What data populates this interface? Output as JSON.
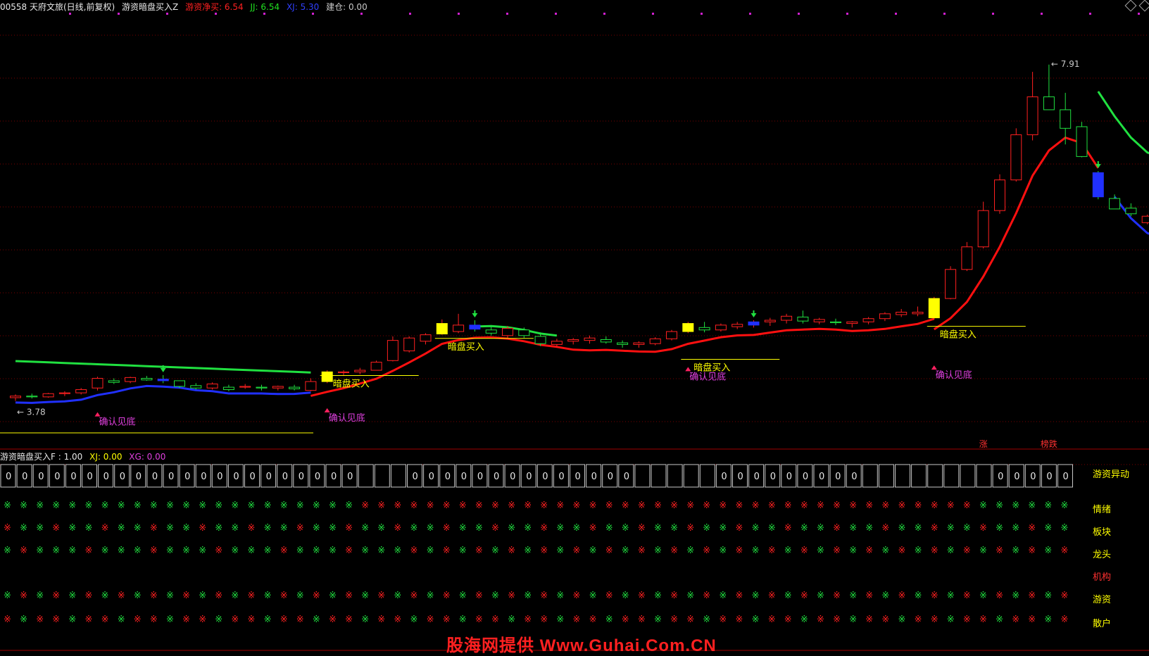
{
  "header": {
    "stock": "00558 天府文旅(日线,前复权)",
    "indicator_name": "游资暗盘买入Z",
    "params": [
      {
        "label": "游资净买: 6.54",
        "color": "#ff2020"
      },
      {
        "label": "JJ: 6.54",
        "color": "#20e020"
      },
      {
        "label": "XJ: 5.30",
        "color": "#3040ff"
      },
      {
        "label": "建仓: 0.00",
        "color": "#c8c8c8"
      }
    ]
  },
  "sub_header": {
    "name": "游资暗盘买入F : 1.00",
    "params": [
      {
        "label": "XJ: 0.00",
        "color": "#ffff00"
      },
      {
        "label": "XG: 0.00",
        "color": "#e040e0"
      }
    ]
  },
  "labels": {
    "buy": "暗盘买入",
    "confirm": "确认见底",
    "high": "7.91",
    "low": "3.78",
    "zhang": "涨",
    "bangdie": "榜跌",
    "watermark": "股海网提供 Www.Guhai.Com.CN"
  },
  "buy_signals": [
    {
      "index": 19,
      "price": 4.16
    },
    {
      "index": 26,
      "price": 4.62
    },
    {
      "index": 41,
      "price": 4.36
    },
    {
      "index": 56,
      "price": 4.77
    }
  ],
  "confirm_signals": [
    {
      "index": 5,
      "price": 3.74
    },
    {
      "index": 19,
      "price": 3.79
    },
    {
      "index": 41,
      "price": 4.3
    },
    {
      "index": 56,
      "price": 4.32
    }
  ],
  "sub_panel": {
    "zero_count": 66,
    "boxes_with_zero": [
      0,
      1,
      2,
      3,
      4,
      5,
      6,
      7,
      8,
      9,
      10,
      11,
      12,
      13,
      14,
      15,
      16,
      17,
      18,
      19,
      20,
      21,
      25,
      26,
      27,
      28,
      29,
      30,
      31,
      32,
      33,
      34,
      35,
      36,
      37,
      38,
      44,
      45,
      46,
      47,
      48,
      49,
      50,
      51,
      52,
      61,
      62,
      63,
      64,
      65
    ],
    "row_labels": [
      "游资异动",
      "情绪",
      "板块",
      "龙头",
      "机构",
      "游资",
      "散户"
    ],
    "row_label_colors": [
      "#ffff00",
      "#ffff00",
      "#ffff00",
      "#ffff00",
      "#ff3030",
      "#ffff00",
      "#ffff00"
    ]
  },
  "chart_data": {
    "type": "candlestick",
    "title": "00558 天府文旅(日线,前复权)",
    "y_range": [
      3.3,
      8.1
    ],
    "candles": [
      [
        3.78,
        3.82,
        3.74,
        3.8
      ],
      [
        3.8,
        3.83,
        3.77,
        3.79
      ],
      [
        3.79,
        3.84,
        3.78,
        3.83
      ],
      [
        3.83,
        3.86,
        3.8,
        3.84
      ],
      [
        3.84,
        3.9,
        3.82,
        3.88
      ],
      [
        3.9,
        4.04,
        3.87,
        4.02
      ],
      [
        3.99,
        4.02,
        3.95,
        3.97
      ],
      [
        3.98,
        4.04,
        3.96,
        4.03
      ],
      [
        4.02,
        4.05,
        3.99,
        4.0
      ],
      [
        4.01,
        4.06,
        3.96,
        3.99
      ],
      [
        3.99,
        3.99,
        3.9,
        3.92
      ],
      [
        3.93,
        3.96,
        3.88,
        3.9
      ],
      [
        3.9,
        3.97,
        3.88,
        3.95
      ],
      [
        3.91,
        3.94,
        3.86,
        3.88
      ],
      [
        3.91,
        3.95,
        3.89,
        3.92
      ],
      [
        3.91,
        3.94,
        3.87,
        3.9
      ],
      [
        3.9,
        3.93,
        3.87,
        3.92
      ],
      [
        3.91,
        3.94,
        3.87,
        3.89
      ],
      [
        3.87,
        4.02,
        3.86,
        3.98
      ],
      [
        3.98,
        4.12,
        3.96,
        4.1
      ],
      [
        4.09,
        4.12,
        4.05,
        4.1
      ],
      [
        4.1,
        4.15,
        4.07,
        4.12
      ],
      [
        4.12,
        4.24,
        4.12,
        4.22
      ],
      [
        4.24,
        4.54,
        4.23,
        4.49
      ],
      [
        4.36,
        4.54,
        4.34,
        4.52
      ],
      [
        4.48,
        4.58,
        4.44,
        4.56
      ],
      [
        4.57,
        4.75,
        4.56,
        4.7
      ],
      [
        4.6,
        4.82,
        4.58,
        4.68
      ],
      [
        4.68,
        4.74,
        4.6,
        4.63
      ],
      [
        4.62,
        4.68,
        4.55,
        4.58
      ],
      [
        4.55,
        4.67,
        4.52,
        4.64
      ],
      [
        4.62,
        4.65,
        4.52,
        4.55
      ],
      [
        4.54,
        4.59,
        4.42,
        4.45
      ],
      [
        4.44,
        4.51,
        4.4,
        4.48
      ],
      [
        4.48,
        4.52,
        4.44,
        4.5
      ],
      [
        4.49,
        4.55,
        4.45,
        4.52
      ],
      [
        4.5,
        4.54,
        4.45,
        4.47
      ],
      [
        4.46,
        4.49,
        4.4,
        4.44
      ],
      [
        4.44,
        4.48,
        4.4,
        4.46
      ],
      [
        4.45,
        4.53,
        4.43,
        4.51
      ],
      [
        4.51,
        4.62,
        4.49,
        4.6
      ],
      [
        4.6,
        4.72,
        4.58,
        4.7
      ],
      [
        4.65,
        4.72,
        4.59,
        4.62
      ],
      [
        4.62,
        4.7,
        4.6,
        4.68
      ],
      [
        4.66,
        4.72,
        4.63,
        4.69
      ],
      [
        4.68,
        4.74,
        4.65,
        4.72
      ],
      [
        4.72,
        4.77,
        4.67,
        4.74
      ],
      [
        4.74,
        4.82,
        4.7,
        4.79
      ],
      [
        4.78,
        4.86,
        4.7,
        4.73
      ],
      [
        4.72,
        4.77,
        4.69,
        4.75
      ],
      [
        4.72,
        4.76,
        4.68,
        4.71
      ],
      [
        4.7,
        4.73,
        4.65,
        4.72
      ],
      [
        4.72,
        4.78,
        4.69,
        4.76
      ],
      [
        4.76,
        4.84,
        4.73,
        4.82
      ],
      [
        4.81,
        4.88,
        4.78,
        4.84
      ],
      [
        4.82,
        4.91,
        4.79,
        4.84
      ],
      [
        4.77,
        5.03,
        4.75,
        5.01
      ],
      [
        5.01,
        5.41,
        5.0,
        5.37
      ],
      [
        5.37,
        5.71,
        5.35,
        5.65
      ],
      [
        5.65,
        6.21,
        5.63,
        6.1
      ],
      [
        6.1,
        6.55,
        6.06,
        6.48
      ],
      [
        6.48,
        7.12,
        6.46,
        7.04
      ],
      [
        7.04,
        7.82,
        6.97,
        7.51
      ],
      [
        7.51,
        7.91,
        7.4,
        7.35
      ],
      [
        7.35,
        7.56,
        6.92,
        7.12
      ],
      [
        7.14,
        7.2,
        6.76,
        6.77
      ],
      [
        6.57,
        6.59,
        6.24,
        6.27
      ],
      [
        6.25,
        6.3,
        6.12,
        6.12
      ],
      [
        6.13,
        6.19,
        6.03,
        6.06
      ],
      [
        5.95,
        6.05,
        5.93,
        6.03
      ],
      [
        6.0,
        6.03,
        5.96,
        6.01
      ]
    ]
  }
}
